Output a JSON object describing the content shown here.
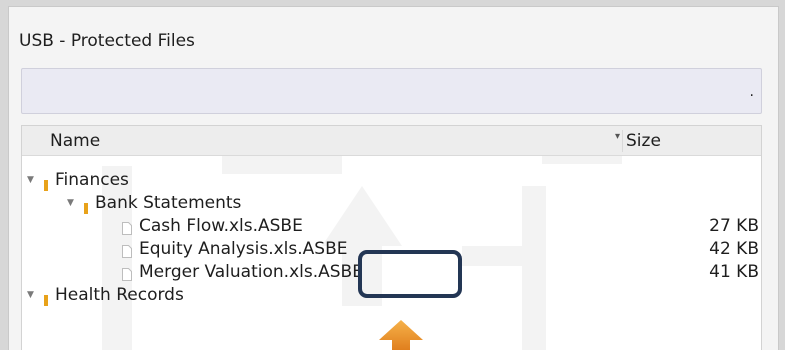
{
  "window": {
    "title": "USB - Protected Files"
  },
  "search": {
    "value": "",
    "indicator": "."
  },
  "columns": {
    "name": "Name",
    "size": "Size"
  },
  "tree": {
    "finances": {
      "label": "Finances",
      "expanded": true
    },
    "bank_statements": {
      "label": "Bank Statements",
      "expanded": true
    },
    "files": [
      {
        "name": "Cash Flow.xls.ASBE",
        "size": "27 KB"
      },
      {
        "name": "Equity Analysis.xls.ASBE",
        "size": "42 KB"
      },
      {
        "name": "Merger Valuation.xls.ASBE",
        "size": "41 KB"
      }
    ],
    "health_records": {
      "label": "Health Records",
      "expanded": true
    }
  },
  "icons": {
    "expander": "triangle-down",
    "folder": "folder-icon",
    "file": "file-icon",
    "sort": "sort-desc"
  },
  "colors": {
    "folder": "#e8a21a",
    "highlight_border": "#233654",
    "pointer_arrow": "#f29a2e"
  }
}
